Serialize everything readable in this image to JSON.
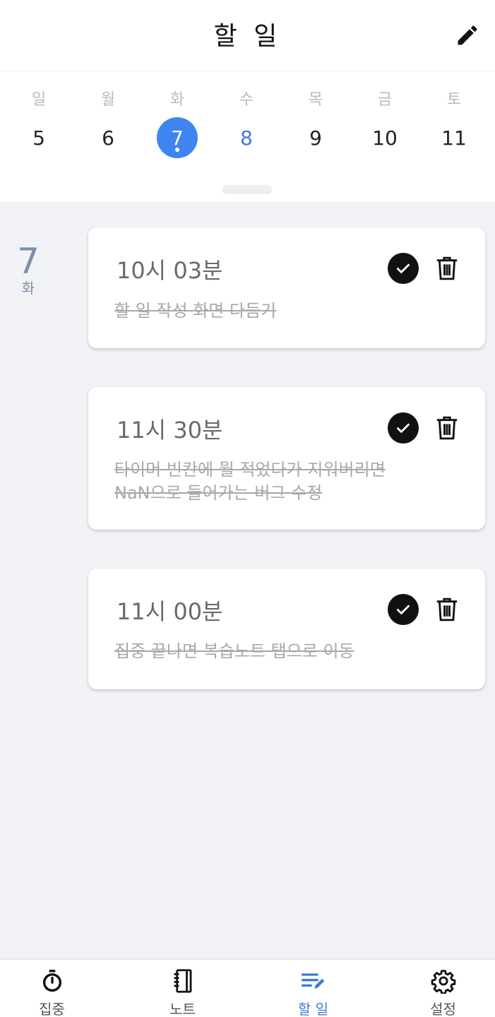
{
  "header": {
    "title": "할 일"
  },
  "calendar": {
    "days": [
      {
        "weekday": "일",
        "date": "5"
      },
      {
        "weekday": "월",
        "date": "6"
      },
      {
        "weekday": "화",
        "date": "7"
      },
      {
        "weekday": "수",
        "date": "8"
      },
      {
        "weekday": "목",
        "date": "9"
      },
      {
        "weekday": "금",
        "date": "10"
      },
      {
        "weekday": "토",
        "date": "11"
      }
    ],
    "selected_index": 2,
    "highlighted_index": 3,
    "accent_color": "#3f85f0"
  },
  "todo_group": {
    "date": "7",
    "weekday": "화"
  },
  "todos": [
    {
      "time": "10시 03분",
      "text": "할 일 작성 화면 다듬기",
      "completed": true
    },
    {
      "time": "11시 30분",
      "text": "타이머 빈칸에 뭘 적었다가 지워버리면 NaN으로 들어가는 버그 수정",
      "completed": true
    },
    {
      "time": "11시 00분",
      "text": "집중 끝나면 복습노트 탭으로 이동",
      "completed": true
    }
  ],
  "nav": {
    "items": [
      {
        "label": "집중",
        "icon": "stopwatch-icon"
      },
      {
        "label": "노트",
        "icon": "notebook-icon"
      },
      {
        "label": "할 일",
        "icon": "todo-list-icon"
      },
      {
        "label": "설정",
        "icon": "gear-icon"
      }
    ],
    "active_index": 2
  }
}
